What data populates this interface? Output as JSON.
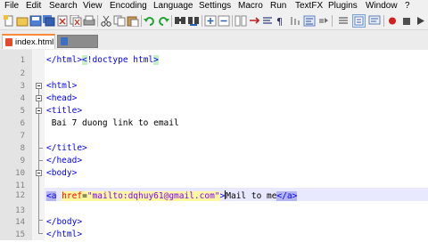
{
  "menu": [
    "File",
    "Edit",
    "Search",
    "View",
    "Encoding",
    "Language",
    "Settings",
    "Macro",
    "Run",
    "TextFX",
    "Plugins",
    "Window",
    "?"
  ],
  "tabs": [
    {
      "label": "index.html",
      "active": true
    },
    {
      "label": "",
      "active": false
    }
  ],
  "toolbar_icons": [
    "new-icon",
    "open-icon",
    "save-icon",
    "save-all-icon",
    "close-icon",
    "close-all-icon",
    "print-icon",
    "cut-icon",
    "copy-icon",
    "paste-icon",
    "undo-icon",
    "redo-icon",
    "find-icon",
    "replace-icon",
    "zoom-in-icon",
    "zoom-out-icon",
    "sync-v-icon",
    "sync-h-icon",
    "wrap-icon",
    "all-chars-icon",
    "indent-guide-icon",
    "lang-icon",
    "doc-map-icon",
    "record-macro-icon",
    "stop-macro-icon"
  ],
  "editor": {
    "lines": [
      {
        "n": "1",
        "text": "</html><!doctype html>"
      },
      {
        "n": "2",
        "text": ""
      },
      {
        "n": "3",
        "text": "<html>"
      },
      {
        "n": "4",
        "text": "<head>"
      },
      {
        "n": "5",
        "text": "<title>"
      },
      {
        "n": "6",
        "text": " Bai 7 duong link to email"
      },
      {
        "n": "7",
        "text": ""
      },
      {
        "n": "8",
        "text": "</title>"
      },
      {
        "n": "9",
        "text": "</head>"
      },
      {
        "n": "10",
        "text": "<body>"
      },
      {
        "n": "11",
        "text": ""
      },
      {
        "n": "12",
        "text": "<a href=\"mailto:dqhuy61@gmail.com\">Mail to me</a>"
      },
      {
        "n": "13",
        "text": ""
      },
      {
        "n": "14",
        "text": "</body>"
      },
      {
        "n": "15",
        "text": "</html>"
      }
    ],
    "colors": {
      "tag": "#0000ff",
      "attr": "#ff0000",
      "value": "#8000ff",
      "current_line": "#e8e8ff"
    }
  }
}
